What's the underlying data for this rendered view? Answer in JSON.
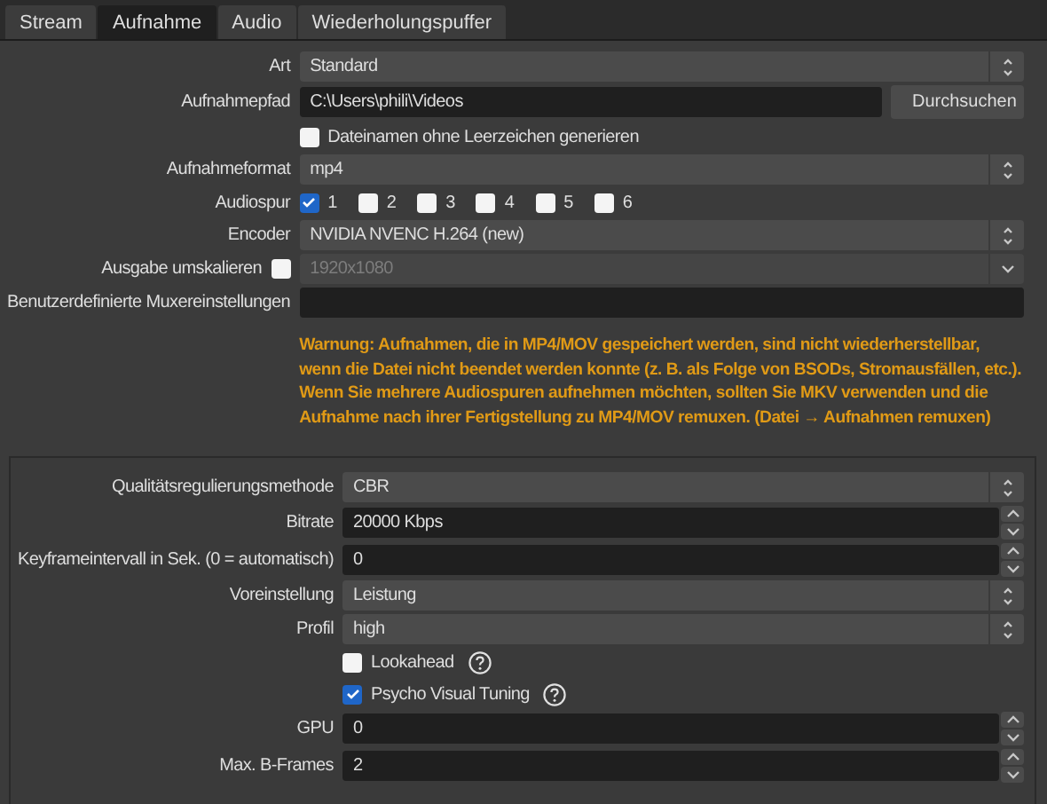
{
  "tabs": [
    {
      "label": "Stream",
      "selected": false
    },
    {
      "label": "Aufnahme",
      "selected": true
    },
    {
      "label": "Audio",
      "selected": false
    },
    {
      "label": "Wiederholungspuffer",
      "selected": false
    }
  ],
  "recording": {
    "rows": [
      {
        "kind": "combo",
        "label": "Art",
        "value": "Standard"
      },
      {
        "kind": "path",
        "label": "Aufnahmepfad",
        "value": "C:\\Users\\phili\\Videos",
        "button": "Durchsuchen"
      },
      {
        "kind": "checkbox",
        "label": "Dateinamen ohne Leerzeichen generieren",
        "checked": false
      },
      {
        "kind": "combo",
        "label": "Aufnahmeformat",
        "value": "mp4"
      },
      {
        "kind": "tracks",
        "label": "Audiospur",
        "tracks": [
          {
            "label": "1",
            "checked": true
          },
          {
            "label": "2",
            "checked": false
          },
          {
            "label": "3",
            "checked": false
          },
          {
            "label": "4",
            "checked": false
          },
          {
            "label": "5",
            "checked": false
          },
          {
            "label": "6",
            "checked": false
          }
        ]
      },
      {
        "kind": "combo",
        "label": "Encoder",
        "value": "NVIDIA NVENC H.264 (new)"
      },
      {
        "kind": "rescale",
        "label": "Ausgabe umskalieren",
        "checked": false,
        "value": "1920x1080"
      },
      {
        "kind": "text",
        "label": "Benutzerdefinierte Muxereinstellungen"
      }
    ],
    "warning": "Warnung: Aufnahmen, die in MP4/MOV gespeichert werden, sind nicht wiederherstellbar, wenn die Datei nicht beendet werden konnte (z. B. als Folge von BSODs, Stromausfällen, etc.). Wenn Sie mehrere Audiospuren aufnehmen möchten, sollten Sie MKV verwenden und die Aufnahme nach ihrer Fertigstellung zu MP4/MOV remuxen. (Datei → Aufnahmen remuxen)"
  },
  "encoder": {
    "rows": [
      {
        "kind": "combo",
        "label": "Qualitätsregulierungsmethode",
        "value": "CBR"
      },
      {
        "kind": "spin",
        "label": "Bitrate",
        "value": "20000 Kbps"
      },
      {
        "kind": "spin",
        "label": "Keyframeintervall in Sek. (0 = automatisch)",
        "value": "0"
      },
      {
        "kind": "combo",
        "label": "Voreinstellung",
        "value": "Leistung"
      },
      {
        "kind": "combo",
        "label": "Profil",
        "value": "high"
      },
      {
        "kind": "checkbox",
        "label": "Lookahead",
        "checked": false,
        "help": true
      },
      {
        "kind": "checkbox",
        "label": "Psycho Visual Tuning",
        "checked": true,
        "help": true
      },
      {
        "kind": "spin",
        "label": "GPU",
        "value": "0"
      },
      {
        "kind": "spin",
        "label": "Max. B-Frames",
        "value": "2"
      }
    ]
  }
}
